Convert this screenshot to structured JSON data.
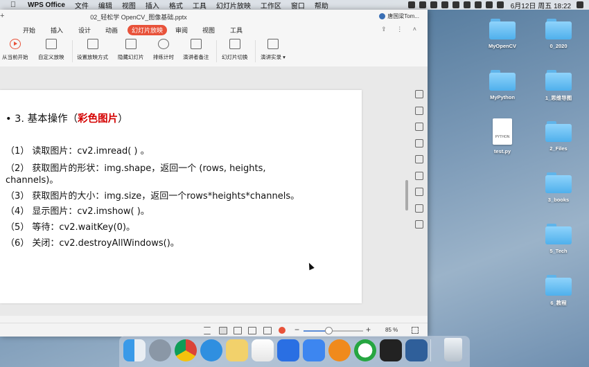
{
  "menubar": {
    "apple": "",
    "items": [
      "WPS Office",
      "文件",
      "编辑",
      "视图",
      "插入",
      "格式",
      "工具",
      "幻灯片放映",
      "工作区",
      "窗口",
      "帮助"
    ],
    "datetime": "6月12日 周五  18:22"
  },
  "window": {
    "title": "02_轻松学 OpenCV_图像基础.pptx",
    "user": "唐国梁Tom...",
    "tabs": [
      "开始",
      "插入",
      "设计",
      "动画",
      "幻灯片放映",
      "审阅",
      "视图",
      "工具"
    ],
    "active_tab": "幻灯片放映",
    "ribbon": [
      "从当前开始",
      "自定义放映",
      "设置放映方式",
      "隐藏幻灯片",
      "排练计时",
      "演讲者备注",
      "幻灯片切换",
      "演讲实录"
    ]
  },
  "slide": {
    "heading_prefix": "• 3. 基本操作（",
    "heading_red": "彩色图片",
    "heading_suffix": "）",
    "lines": [
      "（1） 读取图片：cv2.imread( ) 。",
      "（2） 获取图片的形状：img.shape，返回一个 (rows, heights,",
      "channels)。",
      "（3） 获取图片的大小：img.size，返回一个rows*heights*channels。",
      "（4） 显示图片：cv2.imshow( )。",
      "（5） 等待：cv2.waitKey(0)。",
      "（6） 关闭：cv2.destroyAllWindows()。"
    ]
  },
  "statusbar": {
    "zoom": "85 %",
    "zoom_level": 0.42
  },
  "desktop": {
    "icons": [
      {
        "label": "MyOpenCV",
        "type": "folder"
      },
      {
        "label": "0_2020",
        "type": "folder"
      },
      {
        "label": "MyPython",
        "type": "folder"
      },
      {
        "label": "1_思维导图",
        "type": "folder"
      },
      {
        "label": "test.py",
        "type": "file",
        "badge": "PYTHON"
      },
      {
        "label": "2_Files",
        "type": "folder"
      },
      {
        "label": "3_books",
        "type": "folder"
      },
      {
        "label": "5_Tech",
        "type": "folder"
      },
      {
        "label": "6_教程",
        "type": "folder"
      }
    ]
  },
  "colors": {
    "accent": "#e8523a",
    "heading_red": "#d40000",
    "folder_blue": "#4fb0ec"
  }
}
